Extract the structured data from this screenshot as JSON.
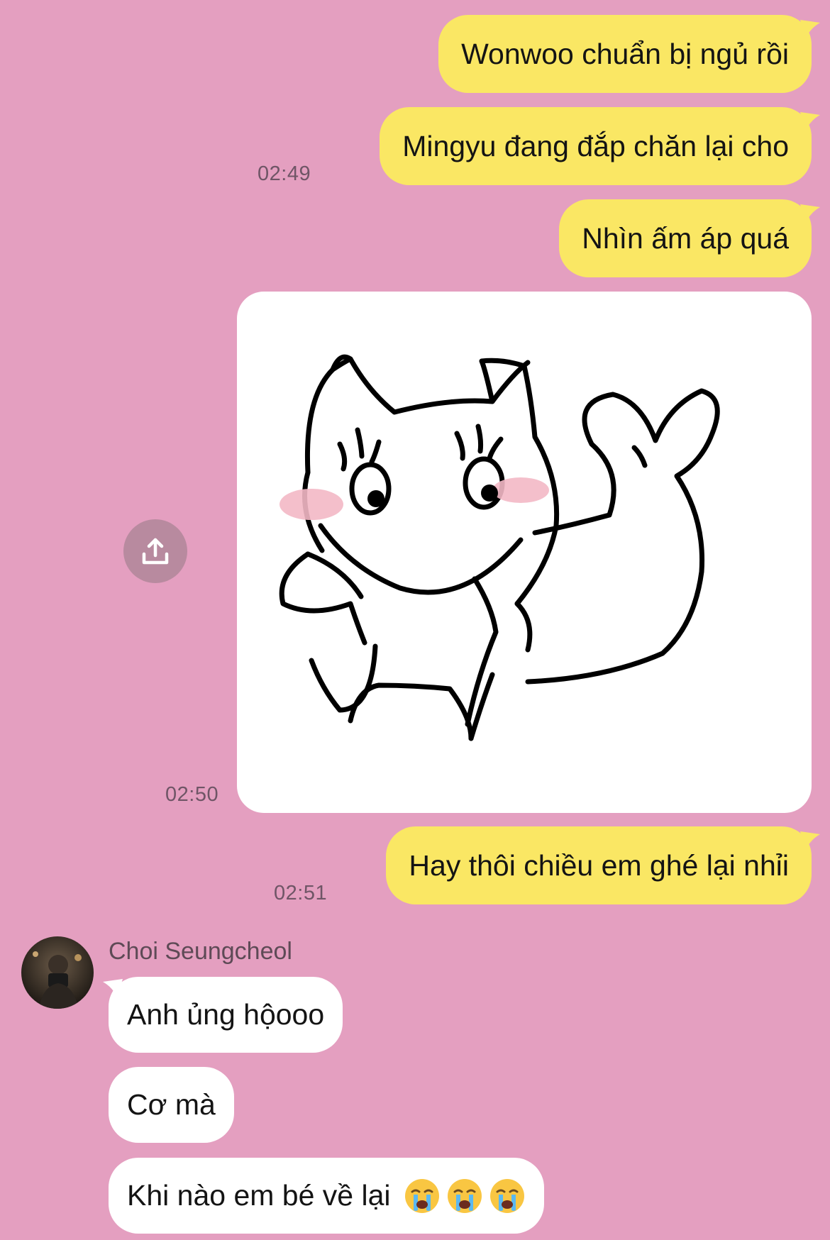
{
  "chat": {
    "outgoing": [
      {
        "text": "Wonwoo chuẩn bị ngủ rồi"
      },
      {
        "text": "Mingyu đang đắp chăn lại cho",
        "time": "02:49"
      },
      {
        "text": "Nhìn ấm áp quá"
      },
      {
        "text": "Hay thôi chiều em ghé lại nhỉi",
        "time": "02:51"
      }
    ],
    "sticker": {
      "time": "02:50",
      "icon": "cat-sticker"
    },
    "share_button": {
      "icon": "share-upload-icon"
    },
    "incoming": {
      "sender": "Choi Seungcheol",
      "messages": [
        {
          "text": "Anh ủng hộooo"
        },
        {
          "text": "Cơ mà"
        },
        {
          "text": "Khi nào em bé về lại",
          "emoji": [
            "crying-face-emoji",
            "crying-face-emoji",
            "crying-face-emoji"
          ]
        }
      ]
    }
  },
  "colors": {
    "background": "#e49fc0",
    "outgoing_bubble": "#fae764",
    "incoming_bubble": "#ffffff",
    "timestamp": "#6f5566"
  }
}
